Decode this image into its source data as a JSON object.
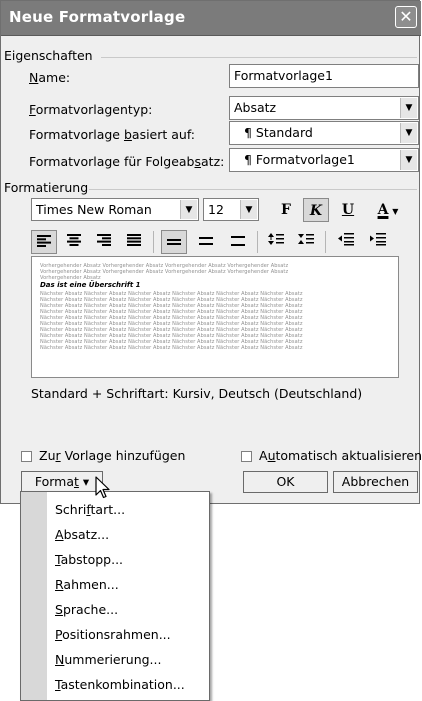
{
  "window": {
    "title": "Neue Formatvorlage",
    "close_glyph": "✕"
  },
  "properties": {
    "group_title": "Eigenschaften",
    "name_label_u": "N",
    "name_label_rest": "ame:",
    "name_value": "Formatvorlage1",
    "type_label_u": "F",
    "type_label_rest": "ormatvorlagentyp:",
    "type_value": "Absatz",
    "based_label_pre": "Formatvorlage ",
    "based_label_u": "b",
    "based_label_post": "asiert auf:",
    "based_value": "¶ Standard",
    "next_label_pre": "Formatvorlage für Folgeab",
    "next_label_u": "s",
    "next_label_post": "atz:",
    "next_value": "¶ Formatvorlage1"
  },
  "formatting": {
    "group_title": "Formatierung",
    "font_name": "Times New Roman",
    "font_size": "12",
    "bold_glyph": "F",
    "italic_glyph": "K",
    "underline_glyph": "U",
    "fontcolor_glyph": "A",
    "dropdown_glyph": "▼"
  },
  "preview": {
    "sample_text": "Vorhergehender Absatz Vorhergehender Absatz Vorhergehender Absatz Vorhergehender Absatz",
    "sample_short": "Vorhergehender Absatz",
    "main_text": "Das ist eine Überschrift 1",
    "following_text": "Nächster Absatz Nächster Absatz Nächster Absatz Nächster Absatz Nächster Absatz Nächster Absatz"
  },
  "description": "Standard + Schriftart: Kursiv, Deutsch (Deutschland)",
  "options": {
    "add_template_pre": "Zu",
    "add_template_u": "r",
    "add_template_post": " Vorlage hinzufügen",
    "auto_update_pre": "A",
    "auto_update_u": "u",
    "auto_update_post": "tomatisch aktualisieren"
  },
  "buttons": {
    "format_pre": "Forma",
    "format_u": "t",
    "format_arrow": "▾",
    "ok": "OK",
    "cancel": "Abbrechen"
  },
  "menu": {
    "items": [
      {
        "pre": "Schri",
        "u": "f",
        "post": "tart..."
      },
      {
        "pre": "",
        "u": "A",
        "post": "bsatz..."
      },
      {
        "pre": "",
        "u": "T",
        "post": "abstopp..."
      },
      {
        "pre": "",
        "u": "R",
        "post": "ahmen..."
      },
      {
        "pre": "",
        "u": "S",
        "post": "prache..."
      },
      {
        "pre": "",
        "u": "P",
        "post": "ositionsrahmen..."
      },
      {
        "pre": "",
        "u": "N",
        "post": "ummerierung..."
      },
      {
        "pre": "",
        "u": "T",
        "post": "astenkombination..."
      }
    ]
  }
}
